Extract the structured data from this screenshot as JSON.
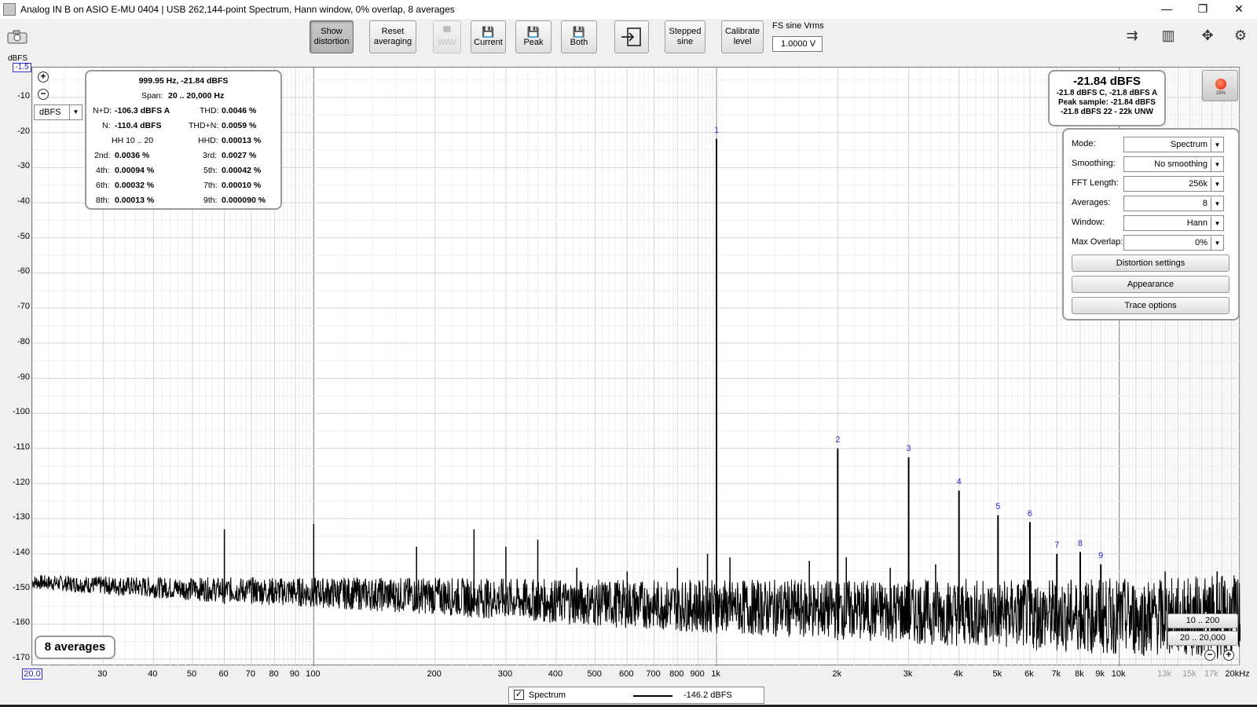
{
  "window": {
    "title": "Analog IN B on ASIO E-MU 0404 | USB 262,144-point Spectrum, Hann window, 0% overlap, 8 averages",
    "minimize": "—",
    "restore": "❐",
    "close": "✕"
  },
  "toolbar": {
    "show_distortion": [
      "Show",
      "distortion"
    ],
    "reset_averaging": [
      "Reset",
      "averaging"
    ],
    "wav": "WAV",
    "current": "Current",
    "peak": "Peak",
    "both": "Both",
    "stepped_sine": [
      "Stepped",
      "sine"
    ],
    "calibrate_level": [
      "Calibrate",
      "level"
    ],
    "fs_label": "FS sine Vrms",
    "fs_value": "1.0000 V"
  },
  "axes": {
    "y_unit": "dBFS",
    "y_top": "-1.5",
    "y_ticks": [
      "-10",
      "-20",
      "-30",
      "-40",
      "-50",
      "-60",
      "-70",
      "-80",
      "-90",
      "-100",
      "-110",
      "-120",
      "-130",
      "-140",
      "-150",
      "-160",
      "-170"
    ],
    "x_left": "20.0",
    "x_ticks": [
      "30",
      "40",
      "50",
      "60",
      "70",
      "80",
      "90",
      "100",
      "200",
      "300",
      "400",
      "500",
      "600",
      "700",
      "800",
      "900",
      "1k",
      "2k",
      "3k",
      "4k",
      "5k",
      "6k",
      "7k",
      "8k",
      "9k",
      "10k",
      "13k",
      "15k",
      "17k",
      "20kHz"
    ],
    "unit_select": "dBFS"
  },
  "distortion": {
    "freq_level": "999.95 Hz, -21.84 dBFS",
    "span_label": "Span:",
    "span_value": "20 .. 20,000 Hz",
    "nd_label": "N+D:",
    "nd_value": "-106.3 dBFS A",
    "thd_label": "THD:",
    "thd_value": "0.0046 %",
    "n_label": "N:",
    "n_value": "-110.4 dBFS",
    "thdn_label": "THD+N:",
    "thdn_value": "0.0059 %",
    "hh_label": "HH 10 .. 20",
    "hhd_label": "HHD:",
    "hhd_value": "0.00013 %",
    "h2_label": "2nd:",
    "h2": "0.0036 %",
    "h3_label": "3rd:",
    "h3": "0.0027 %",
    "h4_label": "4th:",
    "h4": "0.00094 %",
    "h5_label": "5th:",
    "h5": "0.00042 %",
    "h6_label": "6th:",
    "h6": "0.00032 %",
    "h7_label": "7th:",
    "h7": "0.00010 %",
    "h8_label": "8th:",
    "h8": "0.00013 %",
    "h9_label": "9th:",
    "h9": "0.000090 %"
  },
  "level": {
    "main": "-21.84 dBFS",
    "line1": "-21.8 dBFS C, -21.8 dBFS A",
    "line2": "Peak sample: -21.84 dBFS",
    "line3": "-21.8 dBFS 22 - 22k UNW"
  },
  "record": {
    "percent": "28%"
  },
  "settings": {
    "mode_label": "Mode:",
    "mode": "Spectrum",
    "smoothing_label": "Smoothing:",
    "smoothing": "No  smoothing",
    "fft_label": "FFT Length:",
    "fft": "256k",
    "averages_label": "Averages:",
    "averages": "8",
    "window_label": "Window:",
    "window": "Hann",
    "overlap_label": "Max Overlap:",
    "overlap": "0%",
    "distortion_settings": "Distortion settings",
    "appearance": "Appearance",
    "trace_options": "Trace options"
  },
  "averages_badge": "8 averages",
  "ranges": {
    "low": "10 .. 200",
    "high": "20 .. 20,000"
  },
  "legend": {
    "check": "✓",
    "name": "Spectrum",
    "value": "-146.2 dBFS"
  },
  "harmonic_labels": [
    "1",
    "2",
    "3",
    "4",
    "5",
    "6",
    "7",
    "8",
    "9"
  ],
  "chart_data": {
    "type": "line",
    "xlabel": "",
    "ylabel": "dBFS",
    "x_scale": "log",
    "xlim": [
      20,
      20000
    ],
    "ylim": [
      -172,
      -1.5
    ],
    "grid": true,
    "noise_floor": {
      "x": [
        20,
        30,
        50,
        100,
        200,
        500,
        1000,
        2000,
        5000,
        10000,
        20000
      ],
      "y": [
        -148,
        -149,
        -150,
        -151,
        -152,
        -154,
        -155,
        -156,
        -157,
        -158,
        -158
      ]
    },
    "harmonics": [
      {
        "label": "1",
        "x": 1000,
        "y": -21.84
      },
      {
        "label": "2",
        "x": 2000,
        "y": -110
      },
      {
        "label": "3",
        "x": 3000,
        "y": -112.5
      },
      {
        "label": "4",
        "x": 4000,
        "y": -122
      },
      {
        "label": "5",
        "x": 5000,
        "y": -129
      },
      {
        "label": "6",
        "x": 6000,
        "y": -131
      },
      {
        "label": "7",
        "x": 7000,
        "y": -140
      },
      {
        "label": "8",
        "x": 8000,
        "y": -139.5
      },
      {
        "label": "9",
        "x": 9000,
        "y": -143
      }
    ],
    "spurs": [
      {
        "x": 60,
        "y": -133
      },
      {
        "x": 100,
        "y": -131.5
      },
      {
        "x": 180,
        "y": -138
      },
      {
        "x": 250,
        "y": -133
      },
      {
        "x": 300,
        "y": -138
      },
      {
        "x": 360,
        "y": -136
      },
      {
        "x": 450,
        "y": -144
      },
      {
        "x": 600,
        "y": -145
      },
      {
        "x": 800,
        "y": -144
      },
      {
        "x": 950,
        "y": -140
      },
      {
        "x": 1080,
        "y": -141
      },
      {
        "x": 1700,
        "y": -142
      },
      {
        "x": 2100,
        "y": -141
      },
      {
        "x": 2700,
        "y": -144
      },
      {
        "x": 3500,
        "y": -143
      },
      {
        "x": 13000,
        "y": -145
      },
      {
        "x": 17500,
        "y": -145
      }
    ]
  }
}
